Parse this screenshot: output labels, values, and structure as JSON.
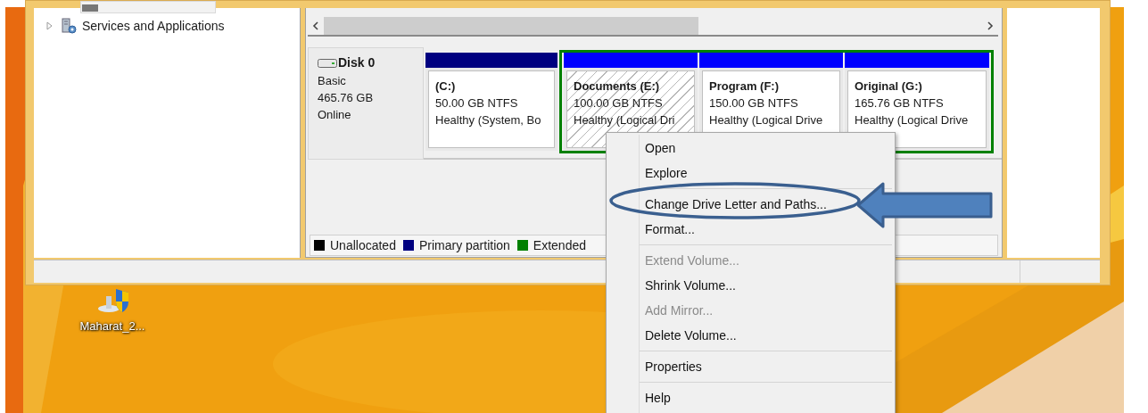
{
  "tree": [
    {
      "label": "Services and Applications",
      "expanded": false
    }
  ],
  "disk": {
    "name": "Disk 0",
    "type": "Basic",
    "size": "465.76 GB",
    "status": "Online"
  },
  "partitions": [
    {
      "kind": "primary",
      "title": "(C:)",
      "size": "50.00 GB NTFS",
      "status": "Healthy (System, Bo",
      "selected": false
    },
    {
      "kind": "logical",
      "title": "Documents  (E:)",
      "size": "100.00 GB NTFS",
      "status": "Healthy (Logical Dri",
      "selected": true
    },
    {
      "kind": "logical",
      "title": "Program  (F:)",
      "size": "150.00 GB NTFS",
      "status": "Healthy (Logical Drive",
      "selected": false
    },
    {
      "kind": "logical",
      "title": "Original  (G:)",
      "size": "165.76 GB NTFS",
      "status": "Healthy (Logical Drive",
      "selected": false
    }
  ],
  "legend": [
    {
      "label": "Unallocated",
      "color": "#000000"
    },
    {
      "label": "Primary partition",
      "color": "#000080"
    },
    {
      "label": "Extended",
      "color": "#008000"
    }
  ],
  "context_menu": [
    [
      {
        "label": "Open",
        "disabled": false
      },
      {
        "label": "Explore",
        "disabled": false
      }
    ],
    [
      {
        "label": "Change Drive Letter and Paths...",
        "disabled": false
      },
      {
        "label": "Format...",
        "disabled": false
      }
    ],
    [
      {
        "label": "Extend Volume...",
        "disabled": true
      },
      {
        "label": "Shrink Volume...",
        "disabled": false
      },
      {
        "label": "Add Mirror...",
        "disabled": true
      },
      {
        "label": "Delete Volume...",
        "disabled": false
      }
    ],
    [
      {
        "label": "Properties",
        "disabled": false
      }
    ],
    [
      {
        "label": "Help",
        "disabled": false
      }
    ]
  ],
  "desktop_icon": {
    "label": "Maharat_2..."
  }
}
